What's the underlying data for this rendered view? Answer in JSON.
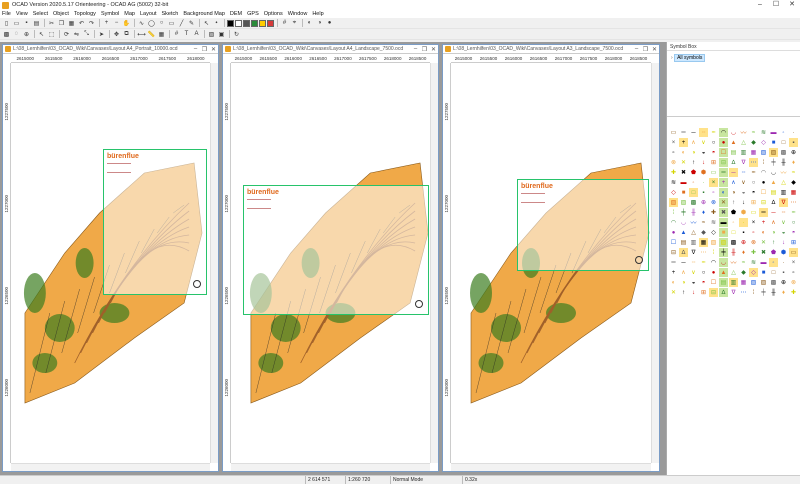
{
  "window": {
    "title": "OCAD Version 2020.5.17 Orienteering - OCAD AG (5002) 32-bit"
  },
  "menu": [
    "File",
    "View",
    "Select",
    "Object",
    "Topology",
    "Symbol",
    "Map",
    "Layout",
    "Sketch",
    "Background Map",
    "DEM",
    "GPS",
    "Options",
    "Window",
    "Help"
  ],
  "documents": [
    {
      "title": "L:\\08_Lernhilfen\\03_OCAD_Wiki\\Canvases\\Layout A4_Portrait_10000.ocd",
      "ruler_x": [
        "2615000",
        "2615500",
        "2616000",
        "2616500",
        "2617000",
        "2617500",
        "2618000"
      ],
      "ruler_y": [
        "1227500",
        "1227000",
        "1226500",
        "1226000"
      ],
      "map_title": "bürenflue",
      "layout": "portrait"
    },
    {
      "title": "L:\\08_Lernhilfen\\03_OCAD_Wiki\\Canvases\\Layout A4_Landscape_7500.ocd",
      "ruler_x": [
        "2615000",
        "2615500",
        "2616000",
        "2616500",
        "2617000",
        "2617500",
        "2618000",
        "2618500"
      ],
      "ruler_y": [
        "1227500",
        "1227000",
        "1226500",
        "1226000"
      ],
      "map_title": "bürenflue",
      "layout": "landscape"
    },
    {
      "title": "L:\\08_Lernhilfen\\03_OCAD_Wiki\\Canvases\\Layout A3_Landscape_7500.ocd",
      "ruler_x": [
        "2615000",
        "2615500",
        "2616000",
        "2616500",
        "2617000",
        "2617500",
        "2618000",
        "2618500"
      ],
      "ruler_y": [
        "1227500",
        "1227000",
        "1226500",
        "1226000"
      ],
      "map_title": "bürenflue",
      "layout": "landscape-small"
    }
  ],
  "symbol_box": {
    "title": "Symbol Box",
    "tree_node": "All symbols"
  },
  "status": {
    "coordinates": "2 614 571",
    "scale": "1:260 720",
    "mode": "Normal Mode",
    "zoom": "0.32x"
  },
  "colors": {
    "map_orange": "#f0a948",
    "map_green": "#3c7d1f",
    "frame_green": "#27c36b",
    "accent": "#e06a1e"
  }
}
